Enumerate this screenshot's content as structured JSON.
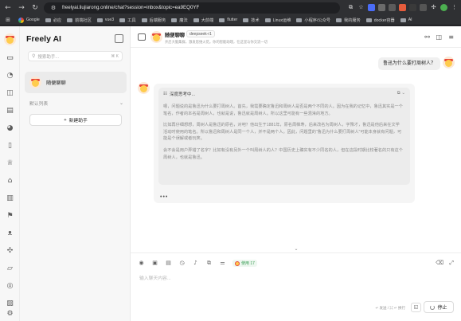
{
  "browser": {
    "url": "freelyai.liujiarong.online/chat?session=inbox&topic=ea9EQ0YF",
    "bookmarks": [
      "Google",
      "必应",
      "前端社区",
      "vue3",
      "工具",
      "后端服务",
      "魔法",
      "大前端",
      "flutter",
      "技术",
      "Linux运维",
      "小程序/公众号",
      "我的服务",
      "docker容器",
      "AI"
    ]
  },
  "sidebar": {
    "brand": "Freely AI",
    "search_placeholder": "搜索助手...",
    "search_shortcut": "⌘ K",
    "session_name": "随便聊聊",
    "default_list": "默认列表",
    "new_assistant": "新建助手"
  },
  "header": {
    "title": "随便聊聊",
    "model": "deepseek-r1",
    "subtitle": "开启大脑集群，激发思维火花。你的智能助理，在这里与你交流一切"
  },
  "conversation": {
    "user_message": "鲁迅为什么要打周树人？",
    "thinking_label": "深度思考中...",
    "thinking_paragraphs": [
      "嗯，问题说的是鲁迅为什么要打周树人。首先，我需要确定鲁迅和周树人是否是两个不同的人。因为在我的记忆中，鲁迅其实是一个笔名，作者的本名是周树人，也就是说，鲁迅就是周树人。所以这里可能有一些混淆的地方。",
      "比如再仔细想想，周树人是鲁迅的原名，对吧？他出生于1881年，原名周樟寿，后来改名为周树人，字豫才，鲁迅是他后来在文学活动时使用的笔名。所以鲁迅和周树人是同一个人，并不是两个人。因此，问题里的“鲁迅为什么要打周树人”可能本身就有问题，可能是个误解或者玩笑。",
      "会不会是用户弄错了名字？比如有没有另外一个叫周树人的人？中国历史上确实有不少同名的人，但在这段时期比较著名的只有这个周树人，也就是鲁迅。"
    ]
  },
  "composer": {
    "usage_label": "使用 17",
    "input_placeholder": "输入聊天内容...",
    "hint": "↵ 发送 / ⌘ ↵ 换行",
    "stop_label": "停止"
  }
}
